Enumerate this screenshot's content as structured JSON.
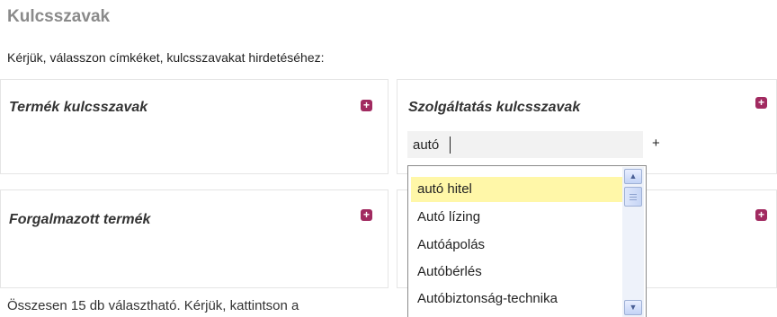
{
  "page": {
    "title": "Kulcsszavak",
    "intro": "Kérjük, válasszon címkéket, kulcsszavakat hirdetéséhez:"
  },
  "panels": [
    {
      "title": "Termék kulcsszavak",
      "add_icon": "plus-square-icon"
    },
    {
      "title": "Szolgáltatás kulcsszavak",
      "add_icon": "plus-square-icon"
    },
    {
      "title": "Forgalmazott termék",
      "add_icon": "plus-square-icon"
    },
    {
      "title": "",
      "add_icon": "plus-square-icon"
    }
  ],
  "search": {
    "value": "autó",
    "add_label": "+"
  },
  "dropdown": {
    "options": [
      "autó hitel",
      "Autó lízing",
      "Autóápolás",
      "Autóbérlés",
      "Autóbiztonság-technika"
    ],
    "highlighted_index": 0,
    "scroll_up_icon": "chevron-up-icon",
    "scroll_down_icon": "chevron-down-icon"
  },
  "footer": {
    "text": "Összesen 15 db választható. Kérjük, kattintson a"
  },
  "colors": {
    "accent": "#a12a60",
    "highlight": "#fff7a8",
    "title_gray": "#8a8a8a"
  }
}
